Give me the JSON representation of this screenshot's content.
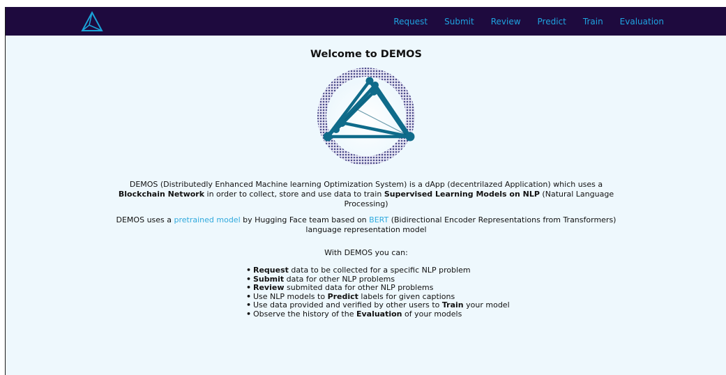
{
  "nav": {
    "items": [
      "Request",
      "Submit",
      "Review",
      "Predict",
      "Train",
      "Evaluation"
    ]
  },
  "main": {
    "title": "Welcome to DEMOS",
    "p1": {
      "t1": "DEMOS (Distributedly Enhanced Machine learning Optimization System) is a dApp (decentrilazed Application) which uses a ",
      "b1": "Blockchain Network",
      "t2": " in order to collect, store and use data to train ",
      "b2": "Supervised Learning Models on NLP",
      "t3": " (Natural Language Processing)"
    },
    "p2": {
      "t1": "DEMOS uses a ",
      "link1": "pretrained model",
      "t2": " by Hugging Face team based on ",
      "link2": "BERT",
      "t3": " (Bidirectional Encoder Representations from Transformers) language representation model"
    },
    "p3": "With DEMOS you can:",
    "features": [
      {
        "bold": "Request",
        "text": " data to be collected for a specific NLP problem",
        "pre": ""
      },
      {
        "bold": "Submit",
        "text": " data for other NLP problems",
        "pre": ""
      },
      {
        "bold": "Review",
        "text": " submited data for other NLP problems",
        "pre": ""
      },
      {
        "pre": "Use NLP models to ",
        "bold": "Predict",
        "text": " labels for given captions"
      },
      {
        "pre": "Use data provided and verified by other users to ",
        "bold": "Train",
        "text": " your model"
      },
      {
        "pre": "Observe the history of the ",
        "bold": "Evaluation",
        "text": " of your models"
      }
    ]
  },
  "colors": {
    "navbar_bg": "#1e0a3e",
    "nav_link": "#1ea3e0",
    "page_bg": "#eef8fd",
    "logo_teal": "#0f6b8a",
    "logo_ring": "#4a4a8a"
  }
}
